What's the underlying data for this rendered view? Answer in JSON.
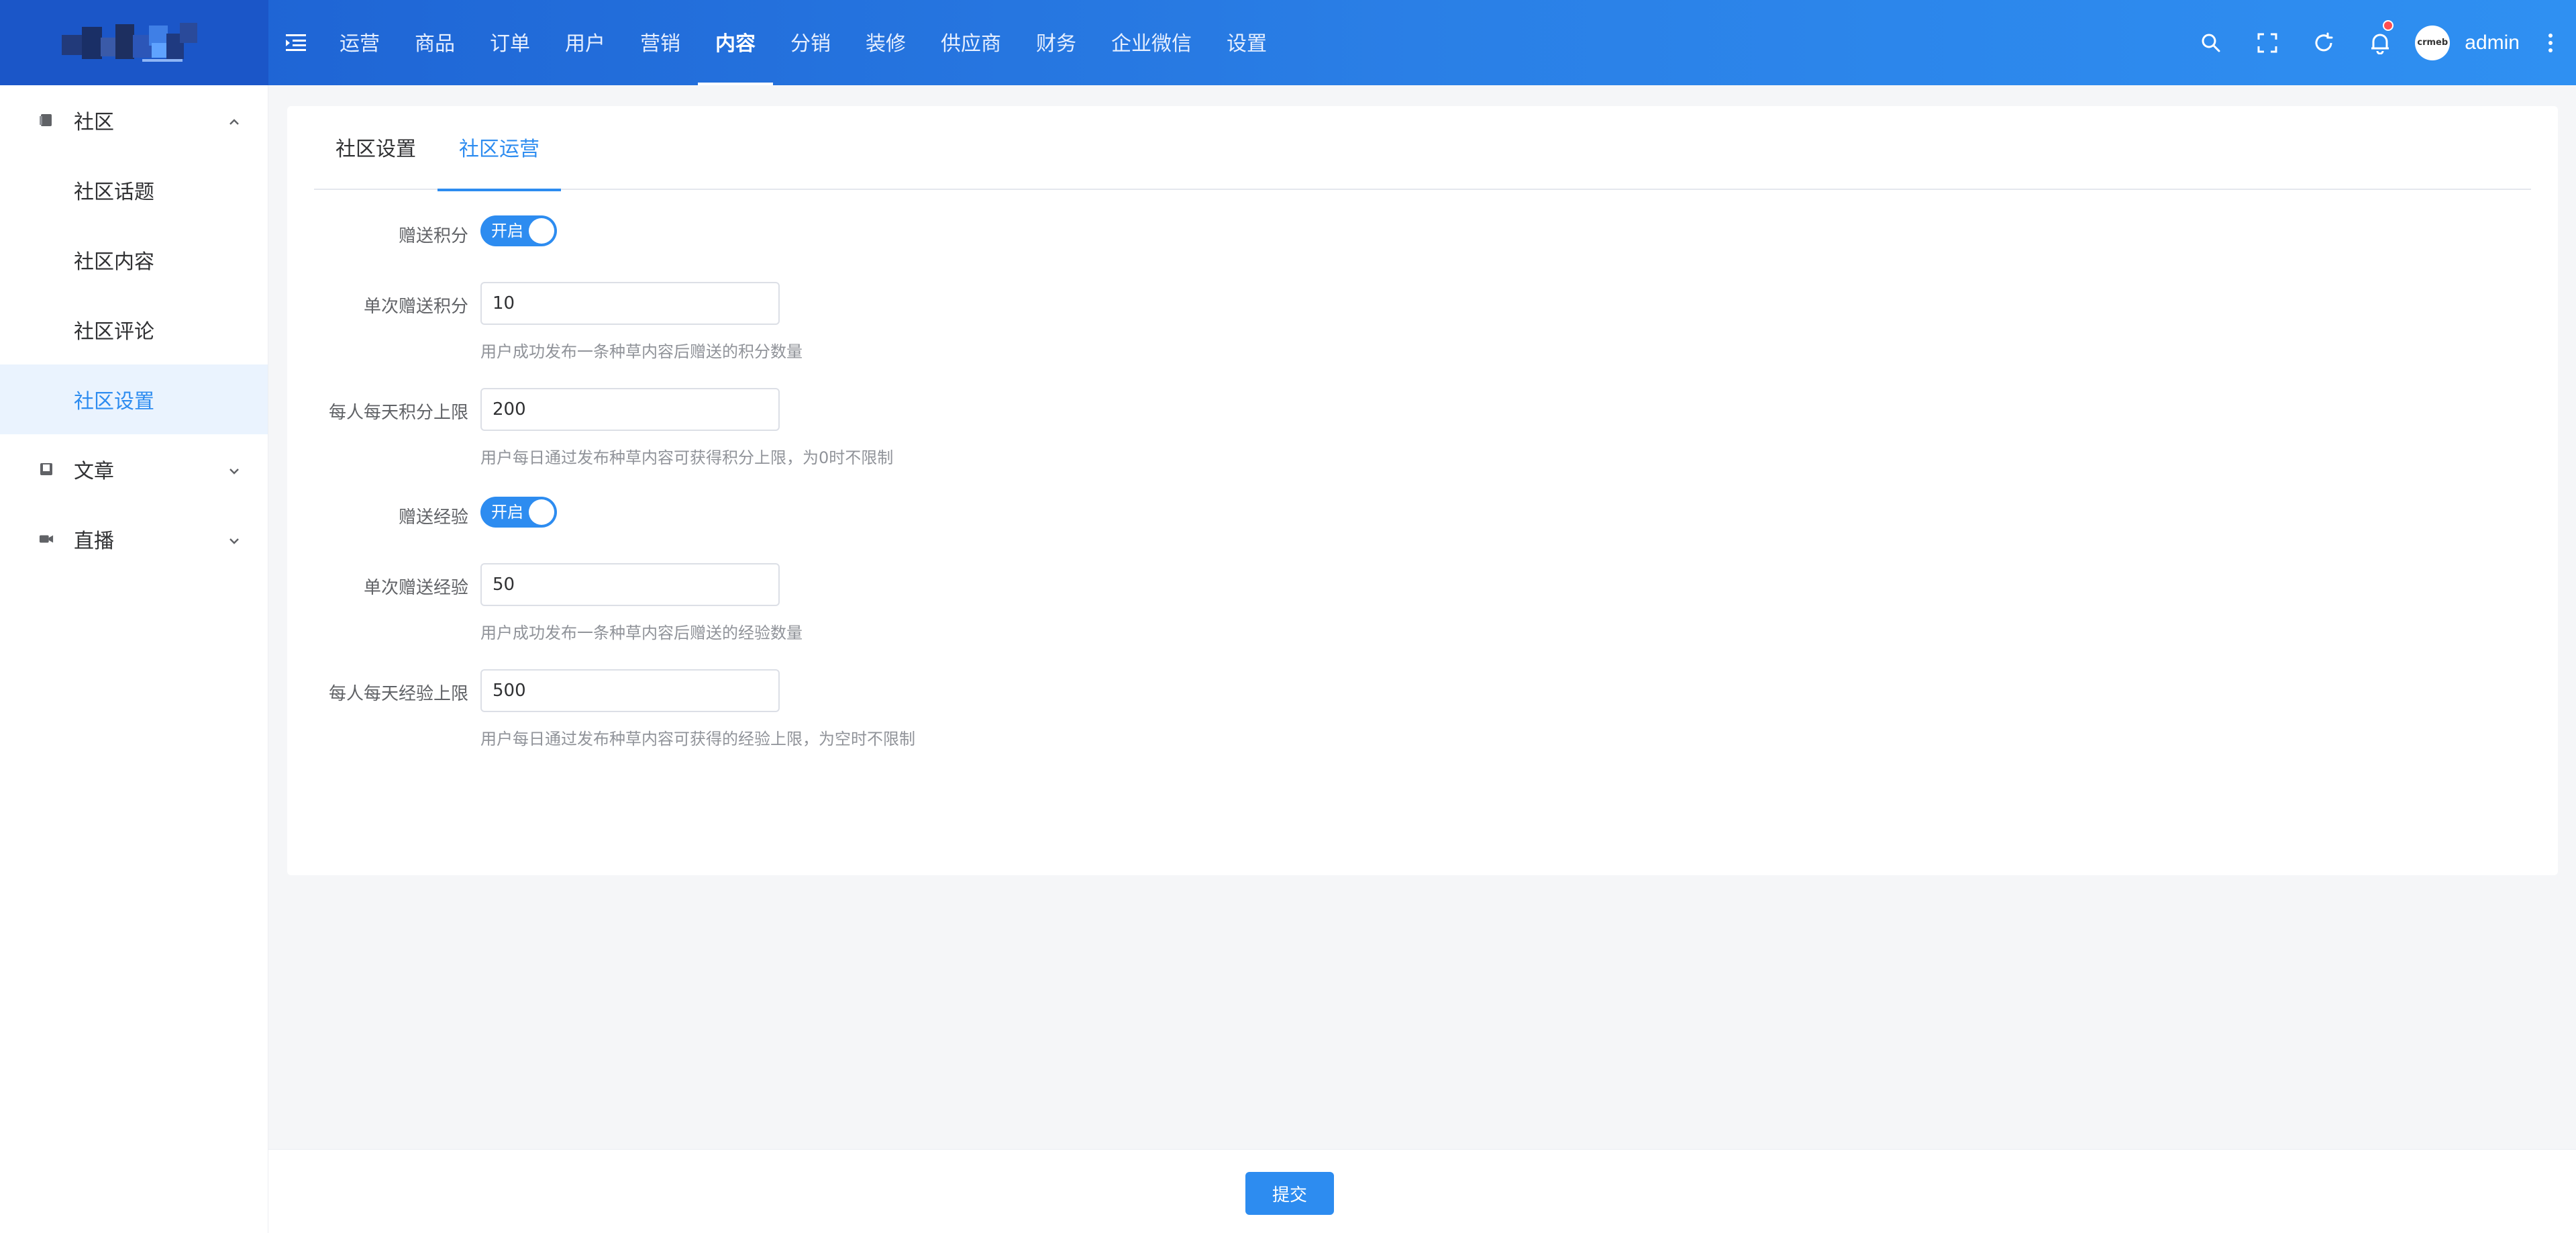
{
  "header": {
    "nav": [
      "运营",
      "商品",
      "订单",
      "用户",
      "营销",
      "内容",
      "分销",
      "装修",
      "供应商",
      "财务",
      "企业微信",
      "设置"
    ],
    "active_nav": "内容",
    "user": {
      "name": "admin",
      "avatar_text": "crmeb"
    },
    "icons": [
      "menu-fold-icon",
      "search-icon",
      "fullscreen-icon",
      "refresh-icon",
      "bell-icon",
      "more-vertical-icon"
    ]
  },
  "sidebar": {
    "groups": [
      {
        "label": "社区",
        "expanded": true,
        "items": [
          "社区话题",
          "社区内容",
          "社区评论",
          "社区设置"
        ],
        "active_item": "社区设置"
      },
      {
        "label": "文章",
        "expanded": false
      },
      {
        "label": "直播",
        "expanded": false
      }
    ]
  },
  "tabs": [
    "社区设置",
    "社区运营"
  ],
  "active_tab": "社区运营",
  "form": {
    "gift_points": {
      "label": "赠送积分",
      "switch_text": "开启",
      "on": true
    },
    "points_per_post": {
      "label": "单次赠送积分",
      "value": "10",
      "hint": "用户成功发布一条种草内容后赠送的积分数量"
    },
    "daily_points_limit": {
      "label": "每人每天积分上限",
      "value": "200",
      "hint": "用户每日通过发布种草内容可获得积分上限，为0时不限制"
    },
    "gift_exp": {
      "label": "赠送经验",
      "switch_text": "开启",
      "on": true
    },
    "exp_per_post": {
      "label": "单次赠送经验",
      "value": "50",
      "hint": "用户成功发布一条种草内容后赠送的经验数量"
    },
    "daily_exp_limit": {
      "label": "每人每天经验上限",
      "value": "500",
      "hint": "用户每日通过发布种草内容可获得的经验上限，为空时不限制"
    }
  },
  "footer": {
    "submit_label": "提交"
  },
  "colors": {
    "primary": "#2d8cf0",
    "header_start": "#1c5fd1",
    "header_end": "#2f90f2",
    "badge": "#ff4d4f"
  }
}
